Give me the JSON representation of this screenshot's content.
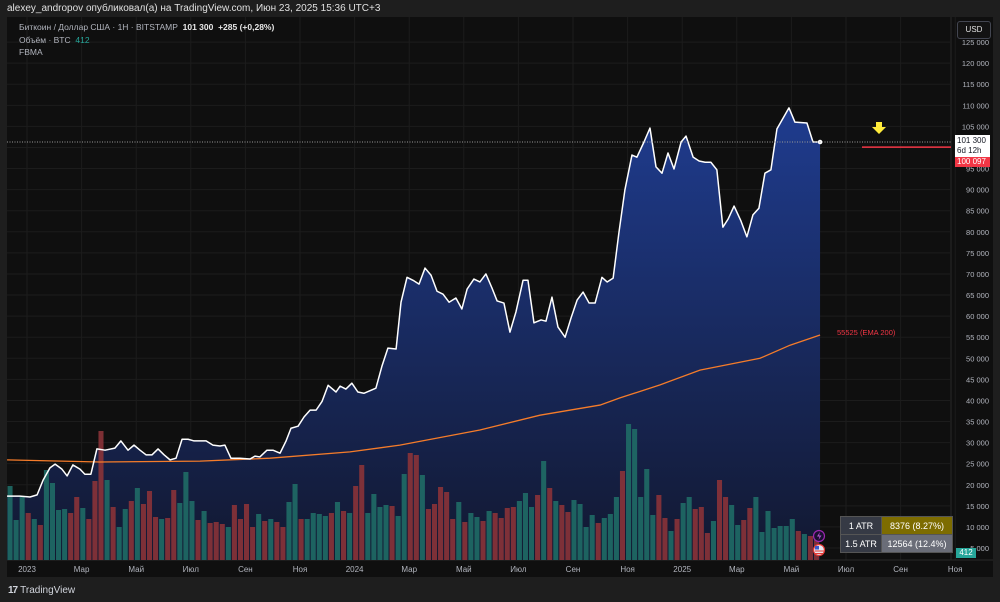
{
  "header": {
    "text": "alexey_andropov опубликовал(а) на TradingView.com, Июн 23, 2025 15:36 UTC+3"
  },
  "legend": {
    "symbol": "Биткоин / Доллар США · 1H · BITSTAMP",
    "price": "101 300",
    "change": "+285 (+0,28%)",
    "volume_label": "Объём · BTC",
    "volume_value": "412",
    "indicator": "FBMA"
  },
  "currency_button": "USD",
  "price_label": {
    "price": "101 300",
    "countdown": "6d 12h"
  },
  "line_label": "100 097",
  "volume_badge": "412",
  "ema_label": "55525 (EMA 200)",
  "atr_table": [
    {
      "label": "1 ATR",
      "value": "8376 (8.27%)"
    },
    {
      "label": "1.5 ATR",
      "value": "12564 (12.4%)"
    }
  ],
  "footer": {
    "logo": "TradingView",
    "logo_mark": "17"
  },
  "colors": {
    "line": "#ffffff",
    "area_top": "#1f3c8f",
    "area_bottom": "#121830",
    "ema": "#f57c2a",
    "vol_up": "#1f6b66",
    "vol_down": "#8a3338",
    "line_level": "#f23645",
    "arrow": "#ffeb3b"
  },
  "chart_data": {
    "type": "area",
    "title": "Биткоин / Доллар США · 1H · BITSTAMP",
    "x_unit": "months since Jan 2023",
    "xlim": [
      -0.73,
      34
    ],
    "ylim": [
      5000,
      125000
    ],
    "y_ticks": [
      "125 000",
      "120 000",
      "115 000",
      "110 000",
      "105 000",
      "100 000",
      "95 000",
      "90 000",
      "85 000",
      "80 000",
      "75 000",
      "70 000",
      "65 000",
      "60 000",
      "55 000",
      "50 000",
      "45 000",
      "40 000",
      "35 000",
      "30 000",
      "25 000",
      "20 000",
      "15 000",
      "10 000",
      "5 000"
    ],
    "x_ticks": [
      {
        "t": 0,
        "label": "2023"
      },
      {
        "t": 2,
        "label": "Мар"
      },
      {
        "t": 4,
        "label": "Май"
      },
      {
        "t": 6,
        "label": "Июл"
      },
      {
        "t": 8,
        "label": "Сен"
      },
      {
        "t": 10,
        "label": "Ноя"
      },
      {
        "t": 12,
        "label": "2024"
      },
      {
        "t": 14,
        "label": "Мар"
      },
      {
        "t": 16,
        "label": "Май"
      },
      {
        "t": 18,
        "label": "Июл"
      },
      {
        "t": 20,
        "label": "Сен"
      },
      {
        "t": 22,
        "label": "Ноя"
      },
      {
        "t": 24,
        "label": "2025"
      },
      {
        "t": 26,
        "label": "Мар"
      },
      {
        "t": 28,
        "label": "Май"
      },
      {
        "t": 30,
        "label": "Июл"
      },
      {
        "t": 32,
        "label": "Сен"
      },
      {
        "t": 34,
        "label": "Ноя"
      }
    ],
    "price": [
      [
        -0.73,
        17300
      ],
      [
        -0.26,
        17300
      ],
      [
        0.11,
        17100
      ],
      [
        0.37,
        17600
      ],
      [
        0.59,
        21100
      ],
      [
        0.84,
        24000
      ],
      [
        1.03,
        24900
      ],
      [
        1.28,
        23700
      ],
      [
        1.47,
        22100
      ],
      [
        1.68,
        24700
      ],
      [
        1.94,
        23700
      ],
      [
        2.12,
        22500
      ],
      [
        2.34,
        22500
      ],
      [
        2.56,
        28500
      ],
      [
        2.86,
        28200
      ],
      [
        3.22,
        28700
      ],
      [
        3.44,
        30400
      ],
      [
        3.7,
        28200
      ],
      [
        3.92,
        29400
      ],
      [
        4.14,
        28200
      ],
      [
        4.36,
        27100
      ],
      [
        4.58,
        27100
      ],
      [
        4.8,
        28500
      ],
      [
        5.02,
        27100
      ],
      [
        5.24,
        25900
      ],
      [
        5.46,
        26300
      ],
      [
        5.68,
        30800
      ],
      [
        5.9,
        30800
      ],
      [
        6.12,
        30400
      ],
      [
        6.56,
        30400
      ],
      [
        6.81,
        29400
      ],
      [
        7.07,
        29200
      ],
      [
        7.25,
        29400
      ],
      [
        7.47,
        26300
      ],
      [
        7.8,
        26300
      ],
      [
        8.17,
        26100
      ],
      [
        8.35,
        26800
      ],
      [
        8.53,
        26600
      ],
      [
        8.79,
        28200
      ],
      [
        9.01,
        28200
      ],
      [
        9.27,
        27500
      ],
      [
        9.49,
        30400
      ],
      [
        9.67,
        33400
      ],
      [
        9.93,
        33900
      ],
      [
        10.15,
        36100
      ],
      [
        10.37,
        37700
      ],
      [
        10.59,
        37700
      ],
      [
        10.81,
        39800
      ],
      [
        11.03,
        43600
      ],
      [
        11.32,
        42000
      ],
      [
        11.47,
        43400
      ],
      [
        11.68,
        42700
      ],
      [
        11.9,
        44100
      ],
      [
        12.12,
        42000
      ],
      [
        12.34,
        41700
      ],
      [
        12.78,
        42900
      ],
      [
        13.0,
        48100
      ],
      [
        13.22,
        52400
      ],
      [
        13.52,
        52200
      ],
      [
        13.7,
        63300
      ],
      [
        13.92,
        69200
      ],
      [
        14.14,
        68500
      ],
      [
        14.36,
        67600
      ],
      [
        14.58,
        71400
      ],
      [
        14.8,
        69700
      ],
      [
        15.02,
        65900
      ],
      [
        15.24,
        65200
      ],
      [
        15.46,
        63300
      ],
      [
        15.71,
        64300
      ],
      [
        15.93,
        61700
      ],
      [
        16.12,
        66400
      ],
      [
        16.37,
        68800
      ],
      [
        16.59,
        68100
      ],
      [
        16.81,
        70000
      ],
      [
        17.03,
        66700
      ],
      [
        17.22,
        63600
      ],
      [
        17.47,
        63100
      ],
      [
        17.69,
        56200
      ],
      [
        17.91,
        61000
      ],
      [
        18.17,
        68500
      ],
      [
        18.35,
        68500
      ],
      [
        18.57,
        58400
      ],
      [
        18.83,
        59100
      ],
      [
        19.01,
        58800
      ],
      [
        19.23,
        64500
      ],
      [
        19.45,
        57400
      ],
      [
        19.71,
        55000
      ],
      [
        19.93,
        59600
      ],
      [
        20.15,
        63800
      ],
      [
        20.37,
        65700
      ],
      [
        20.59,
        63100
      ],
      [
        20.81,
        63100
      ],
      [
        21.06,
        69200
      ],
      [
        21.25,
        68100
      ],
      [
        21.47,
        69000
      ],
      [
        21.68,
        79700
      ],
      [
        21.9,
        89900
      ],
      [
        22.16,
        98200
      ],
      [
        22.34,
        97700
      ],
      [
        22.6,
        101300
      ],
      [
        22.82,
        104600
      ],
      [
        23.04,
        95400
      ],
      [
        23.26,
        93900
      ],
      [
        23.48,
        98700
      ],
      [
        23.7,
        94900
      ],
      [
        23.96,
        101300
      ],
      [
        24.14,
        102700
      ],
      [
        24.4,
        97700
      ],
      [
        24.62,
        96800
      ],
      [
        24.84,
        96500
      ],
      [
        25.05,
        96500
      ],
      [
        25.27,
        94700
      ],
      [
        25.49,
        81100
      ],
      [
        25.68,
        83000
      ],
      [
        25.9,
        86100
      ],
      [
        26.15,
        82600
      ],
      [
        26.37,
        78800
      ],
      [
        26.59,
        84000
      ],
      [
        26.81,
        85600
      ],
      [
        27.03,
        93900
      ],
      [
        27.25,
        94700
      ],
      [
        27.47,
        104400
      ],
      [
        27.91,
        109400
      ],
      [
        28.13,
        106000
      ],
      [
        28.57,
        105800
      ],
      [
        28.79,
        101300
      ],
      [
        29.05,
        101300
      ]
    ],
    "ema200": [
      [
        -0.73,
        25900
      ],
      [
        2.67,
        25400
      ],
      [
        6.34,
        25600
      ],
      [
        8.9,
        26300
      ],
      [
        11.83,
        27800
      ],
      [
        13.66,
        29400
      ],
      [
        16.59,
        33000
      ],
      [
        18.79,
        36500
      ],
      [
        20.99,
        38900
      ],
      [
        21.72,
        40600
      ],
      [
        23.19,
        43700
      ],
      [
        24.65,
        47200
      ],
      [
        26.85,
        50000
      ],
      [
        27.95,
        53100
      ],
      [
        29.05,
        55525
      ]
    ],
    "volume_relative": [
      74,
      40,
      63,
      47,
      41,
      35,
      90,
      77,
      50,
      51,
      47,
      63,
      52,
      41,
      79,
      129,
      80,
      53,
      33,
      51,
      59,
      72,
      56,
      69,
      43,
      41,
      42,
      70,
      57,
      88,
      59,
      40,
      49,
      37,
      38,
      36,
      33,
      55,
      41,
      56,
      33,
      46,
      39,
      41,
      38,
      33,
      58,
      76,
      41,
      41,
      47,
      46,
      44,
      47,
      58,
      49,
      47,
      74,
      95,
      47,
      66,
      53,
      55,
      54,
      44,
      86,
      107,
      105,
      85,
      51,
      56,
      73,
      68,
      41,
      58,
      38,
      47,
      43,
      39,
      49,
      47,
      42,
      52,
      53,
      59,
      67,
      53,
      65,
      99,
      72,
      59,
      55,
      48,
      60,
      56,
      33,
      45,
      37,
      42,
      46,
      63,
      89,
      136,
      131,
      63,
      91,
      45,
      65,
      42,
      29,
      41,
      57,
      63,
      51,
      53,
      27,
      39,
      80,
      63,
      55,
      35,
      40,
      52,
      63,
      28,
      49,
      32,
      34,
      34,
      41,
      29,
      26,
      24,
      26
    ],
    "volume_up": "gggrgrggggrrgrrrgrggrgrrrgrrgggrgrrrgrrrrgrgrrggrggggrgrgrrggggrggrrgrrrrrgrggrgrrrrgggrgrgrrggggrgggrgggggrrgrggrrrgrrggrrgggggggrgrr"
  },
  "volume_direction_note": "",
  "levels": {
    "last_price": 101300,
    "red_line": 100097
  }
}
